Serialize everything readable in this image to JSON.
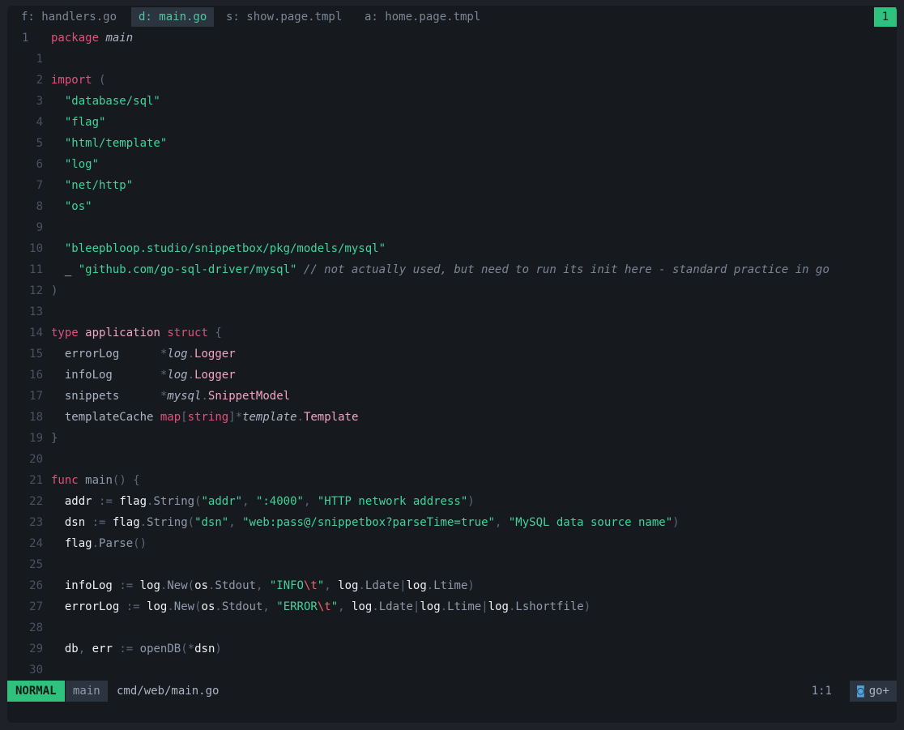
{
  "tabline": {
    "tabs": [
      {
        "key": "f:",
        "name": "handlers.go",
        "active": false
      },
      {
        "key": "d:",
        "name": "main.go",
        "active": true
      },
      {
        "key": "s:",
        "name": "show.page.tmpl",
        "active": false
      },
      {
        "key": "a:",
        "name": "home.page.tmpl",
        "active": false
      }
    ],
    "buffer_count": "1"
  },
  "editor": {
    "language": "go",
    "lines": [
      {
        "n": "1",
        "src": "package main"
      },
      {
        "n": "1",
        "src": ""
      },
      {
        "n": "2",
        "src": "import ("
      },
      {
        "n": "3",
        "src": "  \"database/sql\""
      },
      {
        "n": "4",
        "src": "  \"flag\""
      },
      {
        "n": "5",
        "src": "  \"html/template\""
      },
      {
        "n": "6",
        "src": "  \"log\""
      },
      {
        "n": "7",
        "src": "  \"net/http\""
      },
      {
        "n": "8",
        "src": "  \"os\""
      },
      {
        "n": "9",
        "src": ""
      },
      {
        "n": "10",
        "src": "  \"bleepbloop.studio/snippetbox/pkg/models/mysql\""
      },
      {
        "n": "11",
        "src": "  _ \"github.com/go-sql-driver/mysql\" // not actually used, but need to run its init here - standard practice in go"
      },
      {
        "n": "12",
        "src": ")"
      },
      {
        "n": "13",
        "src": ""
      },
      {
        "n": "14",
        "src": "type application struct {"
      },
      {
        "n": "15",
        "src": "  errorLog      *log.Logger"
      },
      {
        "n": "16",
        "src": "  infoLog       *log.Logger"
      },
      {
        "n": "17",
        "src": "  snippets      *mysql.SnippetModel"
      },
      {
        "n": "18",
        "src": "  templateCache map[string]*template.Template"
      },
      {
        "n": "19",
        "src": "}"
      },
      {
        "n": "20",
        "src": ""
      },
      {
        "n": "21",
        "src": "func main() {"
      },
      {
        "n": "22",
        "src": "  addr := flag.String(\"addr\", \":4000\", \"HTTP network address\")"
      },
      {
        "n": "23",
        "src": "  dsn := flag.String(\"dsn\", \"web:pass@/snippetbox?parseTime=true\", \"MySQL data source name\")"
      },
      {
        "n": "24",
        "src": "  flag.Parse()"
      },
      {
        "n": "25",
        "src": ""
      },
      {
        "n": "26",
        "src": "  infoLog := log.New(os.Stdout, \"INFO\\t\", log.Ldate|log.Ltime)"
      },
      {
        "n": "27",
        "src": "  errorLog := log.New(os.Stdout, \"ERROR\\t\", log.Ldate|log.Ltime|log.Lshortfile)"
      },
      {
        "n": "28",
        "src": ""
      },
      {
        "n": "29",
        "src": "  db, err := openDB(*dsn)"
      },
      {
        "n": "30",
        "src": ""
      }
    ]
  },
  "statusline": {
    "mode": "NORMAL",
    "branch": "main",
    "path": "cmd/web/main.go",
    "position": "1:1",
    "filetype": "go+"
  },
  "colors": {
    "keyword": "#e0527a",
    "string": "#3fd49c",
    "mode_bg": "#2ec27e",
    "background": "#16191e"
  }
}
